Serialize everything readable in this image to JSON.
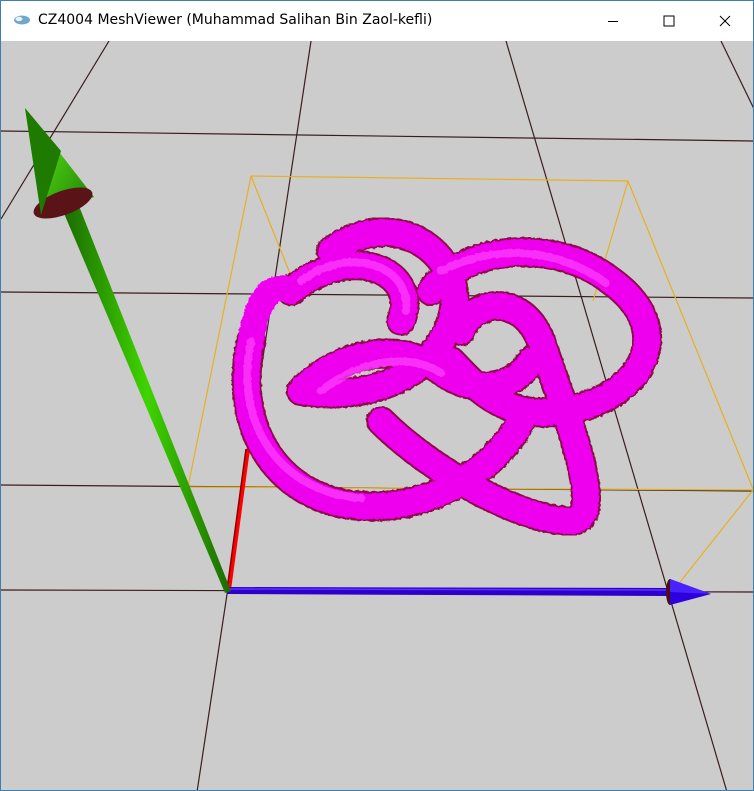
{
  "window": {
    "title": "CZ4004 MeshViewer (Muhammad Salihan Bin Zaol-kefli)",
    "icon": "app-icon",
    "controls": [
      "minimize-icon",
      "maximize-icon",
      "close-icon"
    ]
  },
  "viewport": {
    "background": "#cccccc",
    "grid_color": "#3a1e1e",
    "bounding_box_color": "#e6b020",
    "mesh_color": "#ff00ff",
    "axes": [
      {
        "name": "x-axis",
        "color": "#3300cc"
      },
      {
        "name": "y-axis",
        "color": "#22cc00"
      },
      {
        "name": "z-axis",
        "color": "#ff0000"
      }
    ]
  }
}
